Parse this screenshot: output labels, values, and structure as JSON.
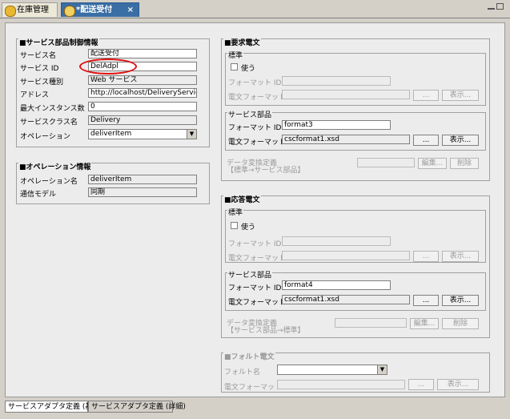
{
  "tabs": {
    "tab1": "在庫管理",
    "tab2": "*配送受付",
    "close": "×"
  },
  "left": {
    "service_group_title": "■サービス部品制御情報",
    "service_name_label": "サービス名",
    "service_name_value": "配送受付",
    "service_id_label": "サービス ID",
    "service_id_value": "DelAdpl",
    "service_type_label": "サービス種別",
    "service_type_value": "Web サービス",
    "address_label": "アドレス",
    "address_value": "http://localhost/DeliveryServiceWe",
    "max_instances_label": "最大インスタンス数",
    "max_instances_value": "0",
    "service_class_label": "サービスクラス名",
    "service_class_value": "Delivery",
    "operation_label": "オペレーション",
    "operation_value": "deliverItem",
    "op_group_title": "■オペレーション情報",
    "op_name_label": "オペレーション名",
    "op_name_value": "deliverItem",
    "comm_model_label": "通信モデル",
    "comm_model_value": "同期"
  },
  "request": {
    "title": "■要求電文",
    "standard_title": "標準",
    "use_label": "使う",
    "format_id_label": "フォーマット ID",
    "msg_format_label": "電文フォーマット",
    "browse": "...",
    "display": "表示...",
    "svc_title": "サービス部品",
    "svc_format_id_label": "フォーマット ID",
    "svc_format_id_value": "format3",
    "svc_msg_format_label": "電文フォーマット",
    "svc_msg_format_value": "cscformat1.xsd",
    "conv_label_1": "データ変換定義",
    "conv_label_2": "【標準→サービス部品】",
    "edit": "編集...",
    "delete": "削除"
  },
  "response": {
    "title": "■応答電文",
    "standard_title": "標準",
    "use_label": "使う",
    "format_id_label": "フォーマット ID",
    "msg_format_label": "電文フォーマット",
    "browse": "...",
    "display": "表示...",
    "svc_title": "サービス部品",
    "svc_format_id_label": "フォーマット ID",
    "svc_format_id_value": "format4",
    "svc_msg_format_label": "電文フォーマット",
    "svc_msg_format_value": "cscformat1.xsd",
    "conv_label_1": "データ変換定義",
    "conv_label_2": "【サービス部品→標準】",
    "edit": "編集...",
    "delete": "削除"
  },
  "fault": {
    "title": "■フォルト電文",
    "fault_name_label": "フォルト名",
    "msg_format_label": "電文フォーマット",
    "browse": "...",
    "display": "表示..."
  },
  "bottom_tabs": {
    "basic": "サービスアダプタ定義 (基本)",
    "detail": "サービスアダプタ定義 (詳細)"
  }
}
